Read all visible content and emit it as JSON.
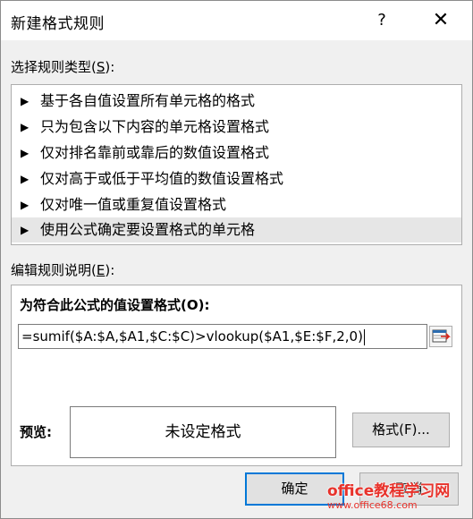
{
  "window": {
    "title": "新建格式规则",
    "help_glyph": "?",
    "close_glyph": "✕"
  },
  "rule_types": {
    "label_prefix": "选择规则类型(",
    "label_key": "S",
    "label_suffix": "):",
    "items": [
      {
        "label": "基于各自值设置所有单元格的格式",
        "selected": false
      },
      {
        "label": "只为包含以下内容的单元格设置格式",
        "selected": false
      },
      {
        "label": "仅对排名靠前或靠后的数值设置格式",
        "selected": false
      },
      {
        "label": "仅对高于或低于平均值的数值设置格式",
        "selected": false
      },
      {
        "label": "仅对唯一值或重复值设置格式",
        "selected": false
      },
      {
        "label": "使用公式确定要设置格式的单元格",
        "selected": true
      }
    ],
    "arrow_glyph": "▶"
  },
  "description": {
    "label_prefix": "编辑规则说明(",
    "label_key": "E",
    "label_suffix": "):",
    "formula_label": "为符合此公式的值设置格式(O):",
    "formula_value": "=sumif($A:$A,$A1,$C:$C)>vlookup($A1,$E:$F,2,0)",
    "preview_label": "预览:",
    "preview_text": "未设定格式",
    "format_button": "格式(F)..."
  },
  "buttons": {
    "ok": "确定",
    "cancel": "取消"
  },
  "watermark": {
    "main": "office教程学习网",
    "sub": "www.office68.com"
  }
}
